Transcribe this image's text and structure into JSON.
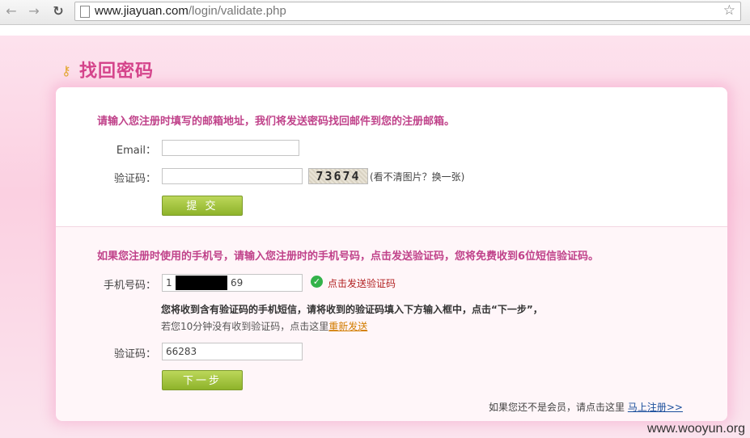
{
  "browser": {
    "url_host": "www.jiayuan.com",
    "url_path": "/login/validate.php",
    "icons": [
      "back-arrow-icon",
      "forward-arrow-icon",
      "reload-icon",
      "page-icon",
      "star-icon"
    ]
  },
  "page": {
    "title": "找回密码",
    "email_section": {
      "intro": "请输入您注册时填写的邮箱地址，我们将发送密码找回邮件到您的注册邮箱。",
      "email_label": "Email：",
      "email_value": "",
      "captcha_label": "验证码：",
      "captcha_value": "",
      "captcha_text": "73674",
      "captcha_hint": "(看不清图片？换一张)",
      "submit_label": "提 交"
    },
    "phone_section": {
      "intro": "如果您注册时使用的手机号，请输入您注册时的手机号码，点击发送验证码，您将免费收到6位短信验证码。",
      "phone_label": "手机号码：",
      "phone_value_start": "1",
      "phone_value_end": "69",
      "send_code_label": "点击发送验证码",
      "instruction": "您将收到含有验证码的手机短信，请将收到的验证码填入下方输入框中，点击“下一步”，",
      "resend_note": "若您10分钟没有收到验证码，点击这里",
      "resend_link": "重新发送",
      "code_label": "验证码：",
      "code_value": "66283",
      "next_label": "下一步"
    },
    "footer": {
      "text": "如果您还不是会员，请点击这里",
      "register_link": "马上注册>>"
    }
  },
  "watermark": "www.wooyun.org",
  "colors": {
    "title_pink": "#d4428a",
    "button_green": "#8eb32a",
    "link_blue": "#1b4f9c"
  }
}
